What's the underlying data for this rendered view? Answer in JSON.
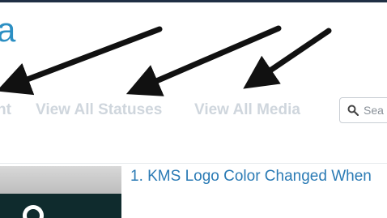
{
  "header": {
    "brand_text": "a"
  },
  "nav": {
    "items": [
      {
        "label": "nt"
      },
      {
        "label": "View All Statuses"
      },
      {
        "label": "View All Media"
      }
    ]
  },
  "search": {
    "placeholder": "Sea",
    "icon": "search-icon"
  },
  "annotations": {
    "arrow_color": "#111111",
    "arrow_count": 3
  },
  "media_list": {
    "items": [
      {
        "title": "1. KMS Logo Color Changed When"
      }
    ]
  },
  "colors": {
    "brand": "#2c8fc3",
    "nav_text": "#cfd6dd",
    "link": "#2b7bb5",
    "top_border": "#1f2f44"
  }
}
